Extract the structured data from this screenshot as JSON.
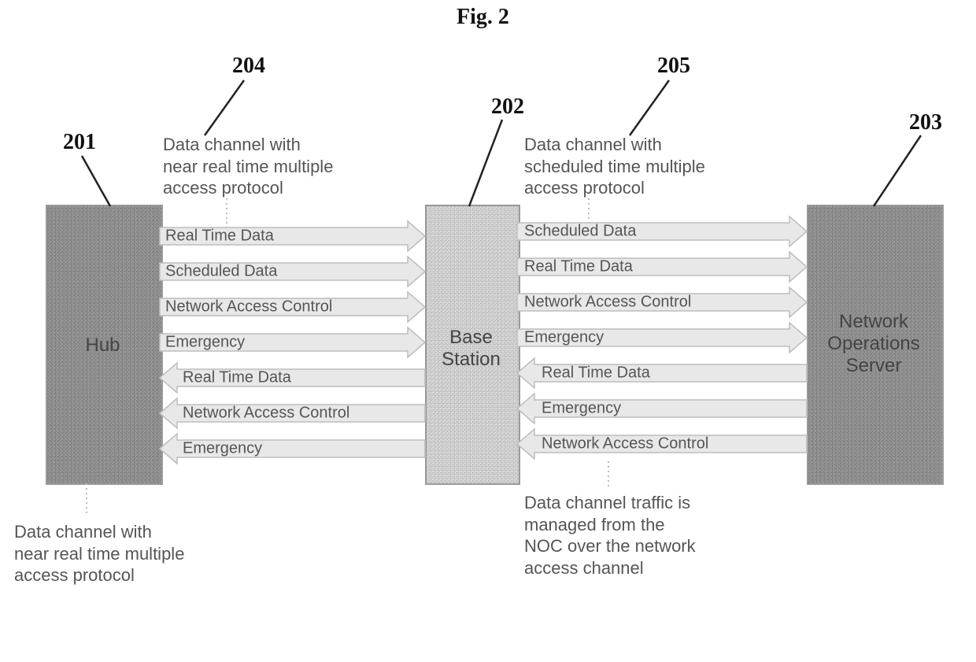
{
  "figure": {
    "title": "Fig. 2"
  },
  "refs": {
    "r201": "201",
    "r202": "202",
    "r203": "203",
    "r204": "204",
    "r205": "205"
  },
  "nodes": {
    "hub": {
      "label": "Hub"
    },
    "base_station": {
      "label": "Base\nStation"
    },
    "nos": {
      "label": "Network\nOperations\nServer"
    }
  },
  "captions": {
    "c1": "Data channel with\nnear real time multiple\naccess protocol",
    "c2": "Data channel with\nnear real time multiple\naccess protocol",
    "c3": "Data channel with\nscheduled time multiple\naccess protocol",
    "c4": "Data channel traffic is\nmanaged from the\nNOC over the network\naccess channel"
  },
  "arrows": {
    "left_right": [
      "Real Time Data",
      "Scheduled Data",
      "Network Access Control",
      "Emergency"
    ],
    "left_left": [
      "Real Time Data",
      "Network Access Control",
      "Emergency"
    ],
    "right_right": [
      "Scheduled Data",
      "Real Time Data",
      "Network Access Control",
      "Emergency"
    ],
    "right_left": [
      "Real Time Data",
      "Emergency",
      "Network Access Control"
    ]
  }
}
